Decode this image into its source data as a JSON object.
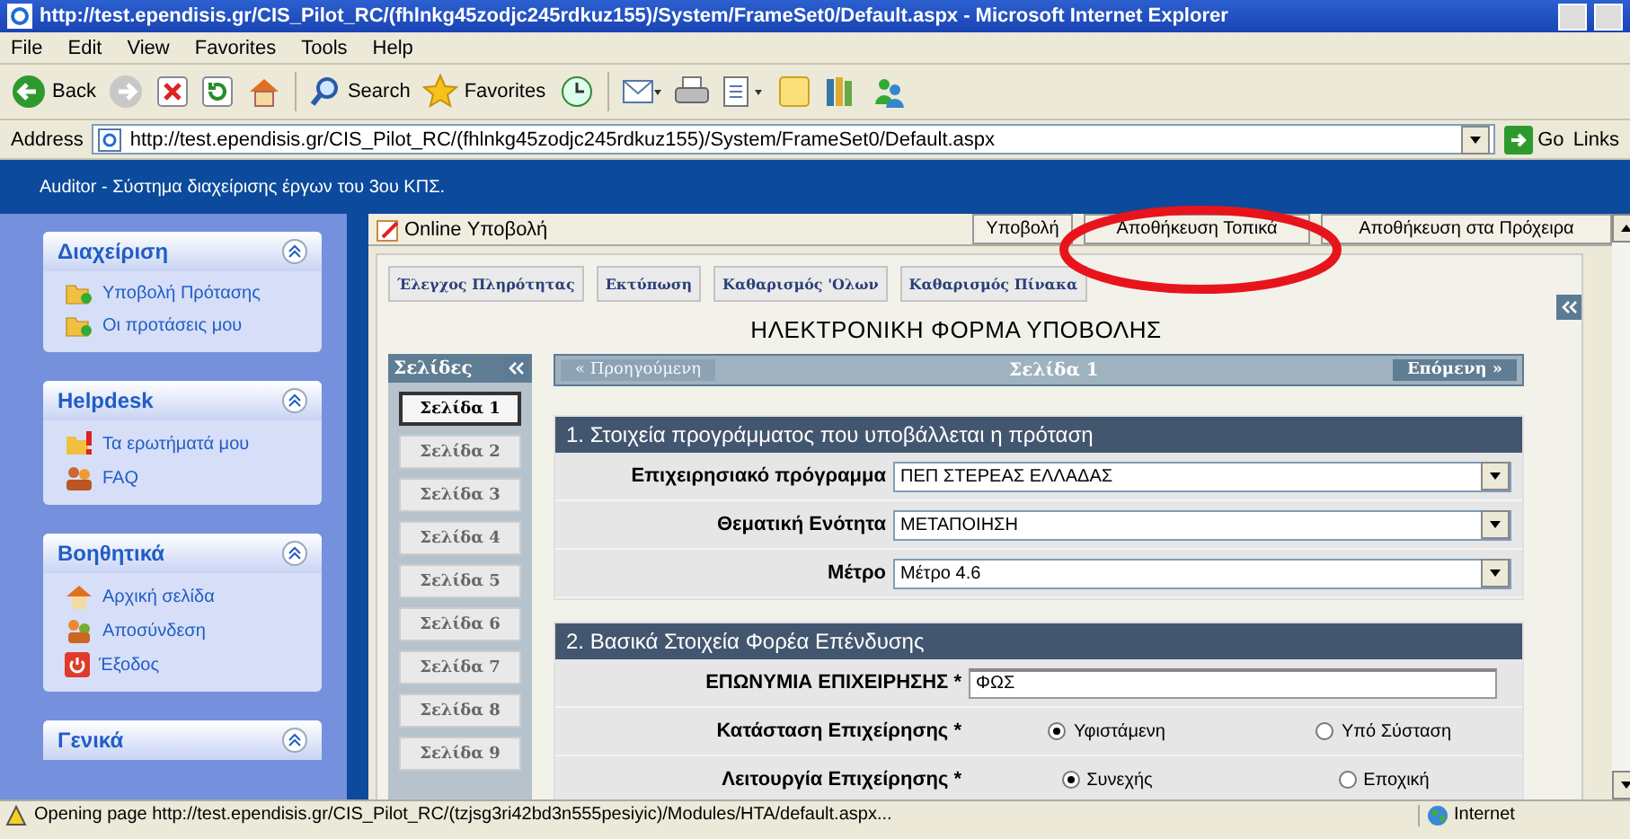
{
  "window": {
    "title": "http://test.ependisis.gr/CIS_Pilot_RC/(fhlnkg45zodjc245rdkuz155)/System/FrameSet0/Default.aspx - Microsoft Internet Explorer"
  },
  "menu": [
    "File",
    "Edit",
    "View",
    "Favorites",
    "Tools",
    "Help"
  ],
  "toolbar": [
    {
      "kind": "back",
      "label": "Back"
    },
    {
      "kind": "forward"
    },
    {
      "kind": "stop"
    },
    {
      "kind": "refresh"
    },
    {
      "kind": "home"
    },
    {
      "kind": "search",
      "label": "Search"
    },
    {
      "kind": "favorites",
      "label": "Favorites"
    },
    {
      "kind": "history"
    },
    {
      "kind": "mail"
    },
    {
      "kind": "print"
    },
    {
      "kind": "edit"
    },
    {
      "kind": "note"
    },
    {
      "kind": "research"
    },
    {
      "kind": "messenger"
    }
  ],
  "address": {
    "label": "Address",
    "value": "http://test.ependisis.gr/CIS_Pilot_RC/(fhlnkg45zodjc245rdkuz155)/System/FrameSet0/Default.aspx",
    "go": "Go",
    "links": "Links"
  },
  "app_header": {
    "title": "Auditor - Σύστημα διαχείρισης έργων του 3ου ΚΠΣ."
  },
  "sidebar": [
    {
      "title": "Διαχείριση",
      "items": [
        {
          "label": "Υποβολή Πρότασης",
          "kind": "folder"
        },
        {
          "label": "Οι προτάσεις μου",
          "kind": "folder"
        }
      ]
    },
    {
      "title": "Helpdesk",
      "items": [
        {
          "label": "Τα ερωτήματά μου",
          "kind": "question"
        },
        {
          "label": "FAQ",
          "kind": "faq"
        }
      ]
    },
    {
      "title": "Βοηθητικά",
      "items": [
        {
          "label": "Αρχική σελίδα",
          "kind": "home"
        },
        {
          "label": "Αποσύνδεση",
          "kind": "logout"
        },
        {
          "label": "Έξοδος",
          "kind": "exit"
        }
      ]
    },
    {
      "title": "Γενικά"
    }
  ],
  "panel": {
    "title": "Online Υποβολή",
    "buttons": [
      "Υποβολή",
      "Αποθήκευση Τοπικά",
      "Αποθήκευση στα Πρόχειρα"
    ]
  },
  "actions": [
    "Έλεγχος Πληρότητας",
    "Εκτύπωση",
    "Καθαρισμός 'Ολων",
    "Καθαρισμός Πίνακα"
  ],
  "form_title": "ΗΛΕΚΤΡΟΝΙΚΗ ΦΟΡΜΑ ΥΠΟΒΟΛΗΣ",
  "pages": {
    "title": "Σελίδες",
    "items": [
      {
        "label": "Σελίδα 1",
        "selected": true
      },
      {
        "label": "Σελίδα 2",
        "selected": false
      },
      {
        "label": "Σελίδα 3",
        "selected": false
      },
      {
        "label": "Σελίδα 4",
        "selected": false
      },
      {
        "label": "Σελίδα 5",
        "selected": false
      },
      {
        "label": "Σελίδα 6",
        "selected": false
      },
      {
        "label": "Σελίδα 7",
        "selected": false
      },
      {
        "label": "Σελίδα 8",
        "selected": false
      },
      {
        "label": "Σελίδα 9",
        "selected": false
      }
    ]
  },
  "nav": {
    "prev": {
      "label": "« Προηγούμενη",
      "disabled": true
    },
    "current": "Σελίδα 1",
    "next": "Επόμενη »"
  },
  "sections": [
    {
      "title": "1. Στοιχεία προγράμματος που υποβάλλεται η πρόταση",
      "fields": [
        {
          "kind": "select",
          "label": "Επιχειρησιακό πρόγραμμα",
          "value": "ΠΕΠ ΣΤΕΡΕΑΣ ΕΛΛΑΔΑΣ"
        },
        {
          "kind": "select",
          "label": "Θεματική Ενότητα",
          "value": "ΜΕΤΑΠΟΙΗΣΗ"
        },
        {
          "kind": "select",
          "label": "Μέτρο",
          "value": "Μέτρο 4.6"
        }
      ]
    },
    {
      "title": "2. Βασικά Στοιχεία Φορέα Επένδυσης",
      "fields": [
        {
          "kind": "text",
          "label": "ΕΠΩΝΥΜΙΑ ΕΠΙΧΕΙΡΗΣΗΣ *",
          "value": "ΦΩΣ"
        },
        {
          "kind": "radio",
          "label": "Κατάσταση Επιχείρησης *",
          "options": [
            {
              "label": "Υφιστάμενη",
              "selected": true
            },
            {
              "label": "Υπό Σύσταση",
              "selected": false
            }
          ]
        },
        {
          "kind": "radio",
          "label": "Λειτουργία Επιχείρησης *",
          "options": [
            {
              "label": "Συνεχής",
              "selected": true
            },
            {
              "label": "Εποχική",
              "selected": false
            }
          ]
        }
      ]
    }
  ],
  "status": {
    "text": "Opening page http://test.ependisis.gr/CIS_Pilot_RC/(tzjsg3ri42bd3n555pesiyic)/Modules/HTA/default.aspx...",
    "zone": "Internet"
  }
}
